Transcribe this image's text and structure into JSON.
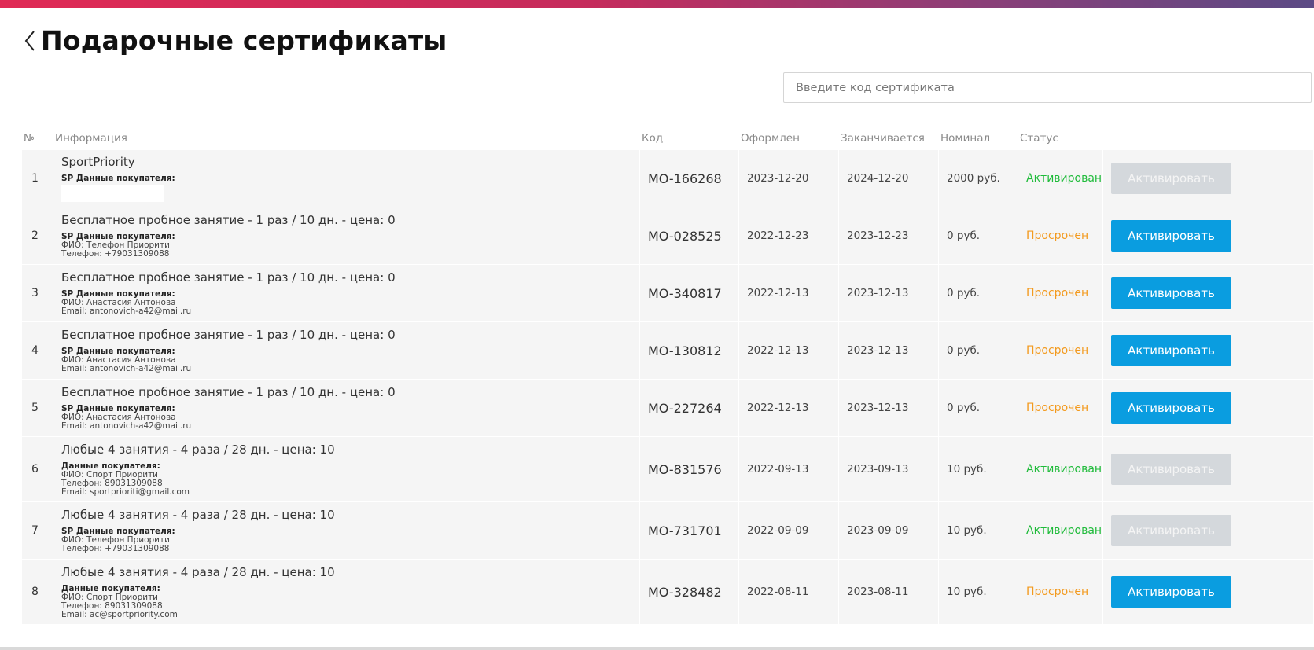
{
  "header": {
    "title": "Подарочные сертификаты"
  },
  "search": {
    "placeholder": "Введите код сертификата",
    "value": ""
  },
  "columns": {
    "num": "№",
    "info": "Информация",
    "code": "Код",
    "issued": "Оформлен",
    "expires": "Заканчивается",
    "nominal": "Номинал",
    "status": "Статус"
  },
  "colors": {
    "accent": "#0a9de0",
    "active": "#1fbb3a",
    "expired": "#f39a1e",
    "disabled": "#d4d8dc"
  },
  "rows": [
    {
      "num": "1",
      "title": "SportPriority",
      "buyer_head": "SP Данные покупателя:",
      "lines": [],
      "blank": true,
      "code": "MO-166268",
      "issued": "2023-12-20",
      "expires": "2024-12-20",
      "nominal": "2000 руб.",
      "status": "Активирован",
      "status_type": "active",
      "button": "Активировать",
      "button_enabled": false,
      "height": 72
    },
    {
      "num": "2",
      "title": "Бесплатное пробное занятие - 1 раз / 10 дн. - цена: 0",
      "buyer_head": "SP Данные покупателя:",
      "lines": [
        "ФИО: Телефон Приорити",
        "Телефон: +79031309088"
      ],
      "code": "MO-028525",
      "issued": "2022-12-23",
      "expires": "2023-12-23",
      "nominal": "0 руб.",
      "status": "Просрочен",
      "status_type": "expired",
      "button": "Активировать",
      "button_enabled": true,
      "height": 72
    },
    {
      "num": "3",
      "title": "Бесплатное пробное занятие - 1 раз / 10 дн. - цена: 0",
      "buyer_head": "SP Данные покупателя:",
      "lines": [
        "ФИО: Анастасия Антонова",
        "Email: antonovich-a42@mail.ru"
      ],
      "code": "MO-340817",
      "issued": "2022-12-13",
      "expires": "2023-12-13",
      "nominal": "0 руб.",
      "status": "Просрочен",
      "status_type": "expired",
      "button": "Активировать",
      "button_enabled": true,
      "height": 72
    },
    {
      "num": "4",
      "title": "Бесплатное пробное занятие - 1 раз / 10 дн. - цена: 0",
      "buyer_head": "SP Данные покупателя:",
      "lines": [
        "ФИО: Анастасия Антонова",
        "Email: antonovich-a42@mail.ru"
      ],
      "code": "MO-130812",
      "issued": "2022-12-13",
      "expires": "2023-12-13",
      "nominal": "0 руб.",
      "status": "Просрочен",
      "status_type": "expired",
      "button": "Активировать",
      "button_enabled": true,
      "height": 72
    },
    {
      "num": "5",
      "title": "Бесплатное пробное занятие - 1 раз / 10 дн. - цена: 0",
      "buyer_head": "SP Данные покупателя:",
      "lines": [
        "ФИО: Анастасия Антонова",
        "Email: antonovich-a42@mail.ru"
      ],
      "code": "MO-227264",
      "issued": "2022-12-13",
      "expires": "2023-12-13",
      "nominal": "0 руб.",
      "status": "Просрочен",
      "status_type": "expired",
      "button": "Активировать",
      "button_enabled": true,
      "height": 72
    },
    {
      "num": "6",
      "title": "Любые 4 занятия - 4 раза / 28 дн. - цена: 10",
      "buyer_head": "Данные покупателя:",
      "lines": [
        "ФИО: Спорт Приорити",
        "Телефон: 89031309088",
        "Email: sportprioriti@gmail.com"
      ],
      "code": "MO-831576",
      "issued": "2022-09-13",
      "expires": "2023-09-13",
      "nominal": "10 руб.",
      "status": "Активирован",
      "status_type": "active",
      "button": "Активировать",
      "button_enabled": false,
      "height": 82
    },
    {
      "num": "7",
      "title": "Любые 4 занятия - 4 раза / 28 дн. - цена: 10",
      "buyer_head": "SP Данные покупателя:",
      "lines": [
        "ФИО: Телефон Приорити",
        "Телефон: +79031309088"
      ],
      "code": "MO-731701",
      "issued": "2022-09-09",
      "expires": "2023-09-09",
      "nominal": "10 руб.",
      "status": "Активирован",
      "status_type": "active",
      "button": "Активировать",
      "button_enabled": false,
      "height": 72
    },
    {
      "num": "8",
      "title": "Любые 4 занятия - 4 раза / 28 дн. - цена: 10",
      "buyer_head": "Данные покупателя:",
      "lines": [
        "ФИО: Спорт Приорити",
        "Телефон: 89031309088",
        "Email: ac@sportpriority.com"
      ],
      "code": "MO-328482",
      "issued": "2022-08-11",
      "expires": "2023-08-11",
      "nominal": "10 руб.",
      "status": "Просрочен",
      "status_type": "expired",
      "button": "Активировать",
      "button_enabled": true,
      "height": 82
    }
  ]
}
